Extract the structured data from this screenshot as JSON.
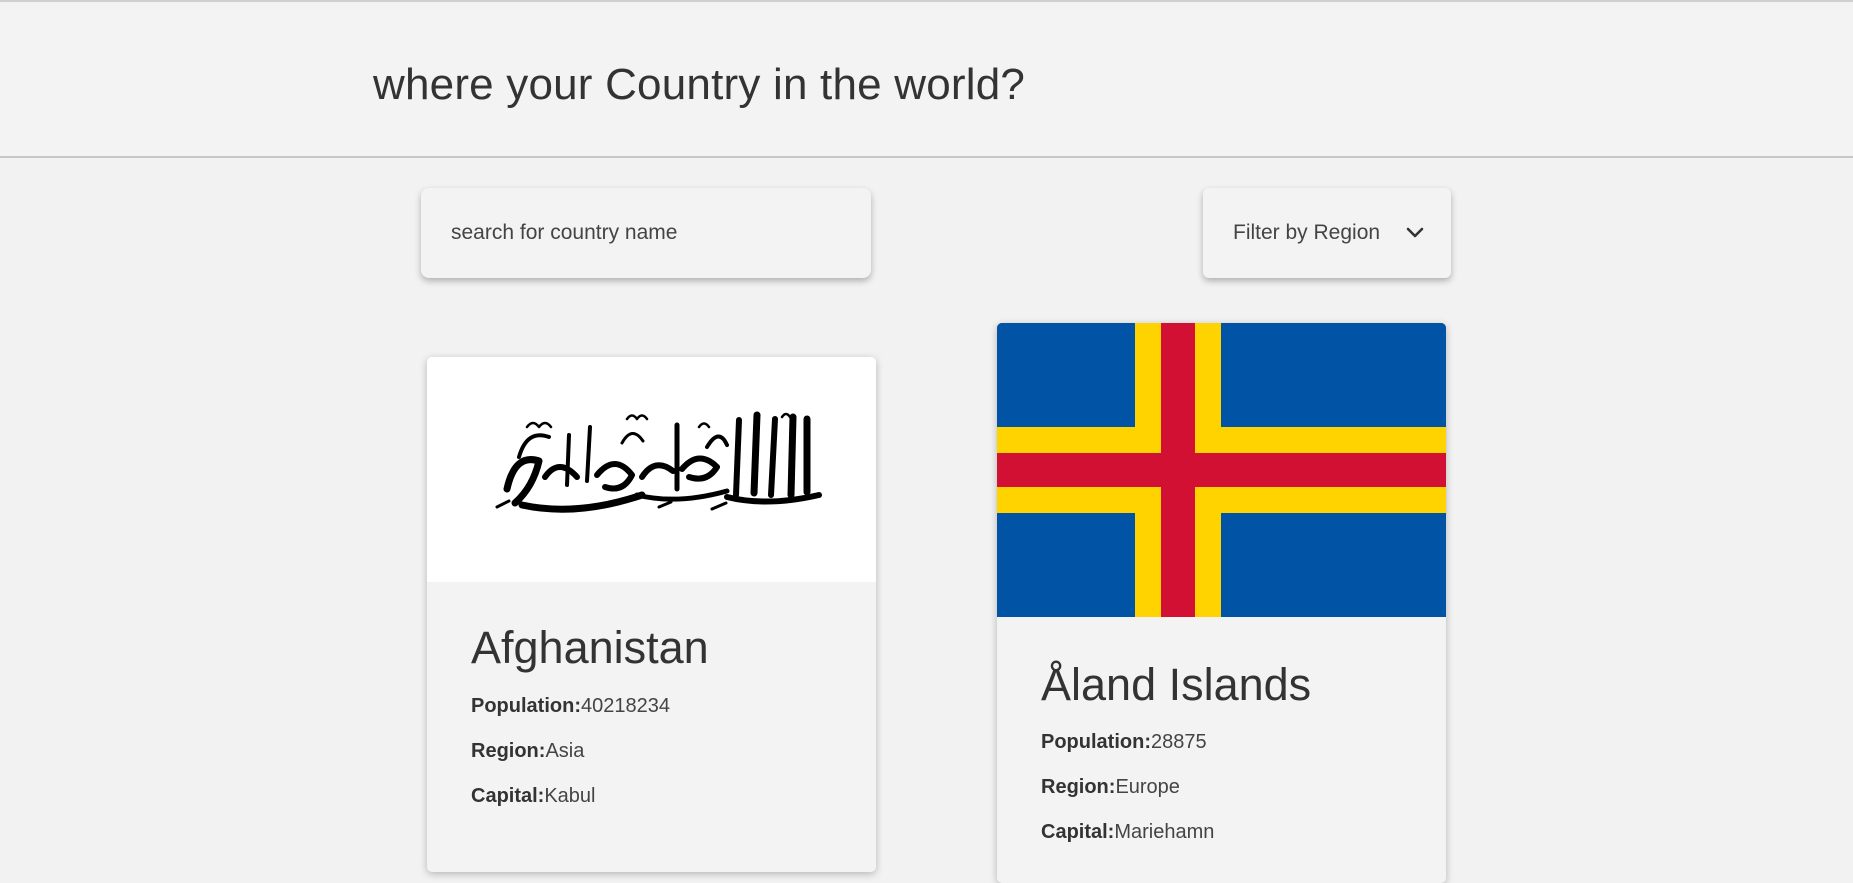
{
  "header": {
    "title": "where your Country in the world?"
  },
  "search": {
    "placeholder": "search for country name",
    "value": ""
  },
  "filter": {
    "label": "Filter by Region",
    "icon": "chevron-down-icon"
  },
  "labels": {
    "population": "Population:",
    "region": "Region:",
    "capital": "Capital:"
  },
  "countries": [
    {
      "name": "Afghanistan",
      "population": "40218234",
      "region": "Asia",
      "capital": "Kabul",
      "flag": "afghanistan-flag"
    },
    {
      "name": "Åland Islands",
      "population": "28875",
      "region": "Europe",
      "capital": "Mariehamn",
      "flag": "aland-islands-flag"
    }
  ],
  "colors": {
    "background": "#f2f2f2",
    "text": "#333333",
    "aland_blue": "#0053a5",
    "aland_yellow": "#ffd300",
    "aland_red": "#d21034"
  }
}
